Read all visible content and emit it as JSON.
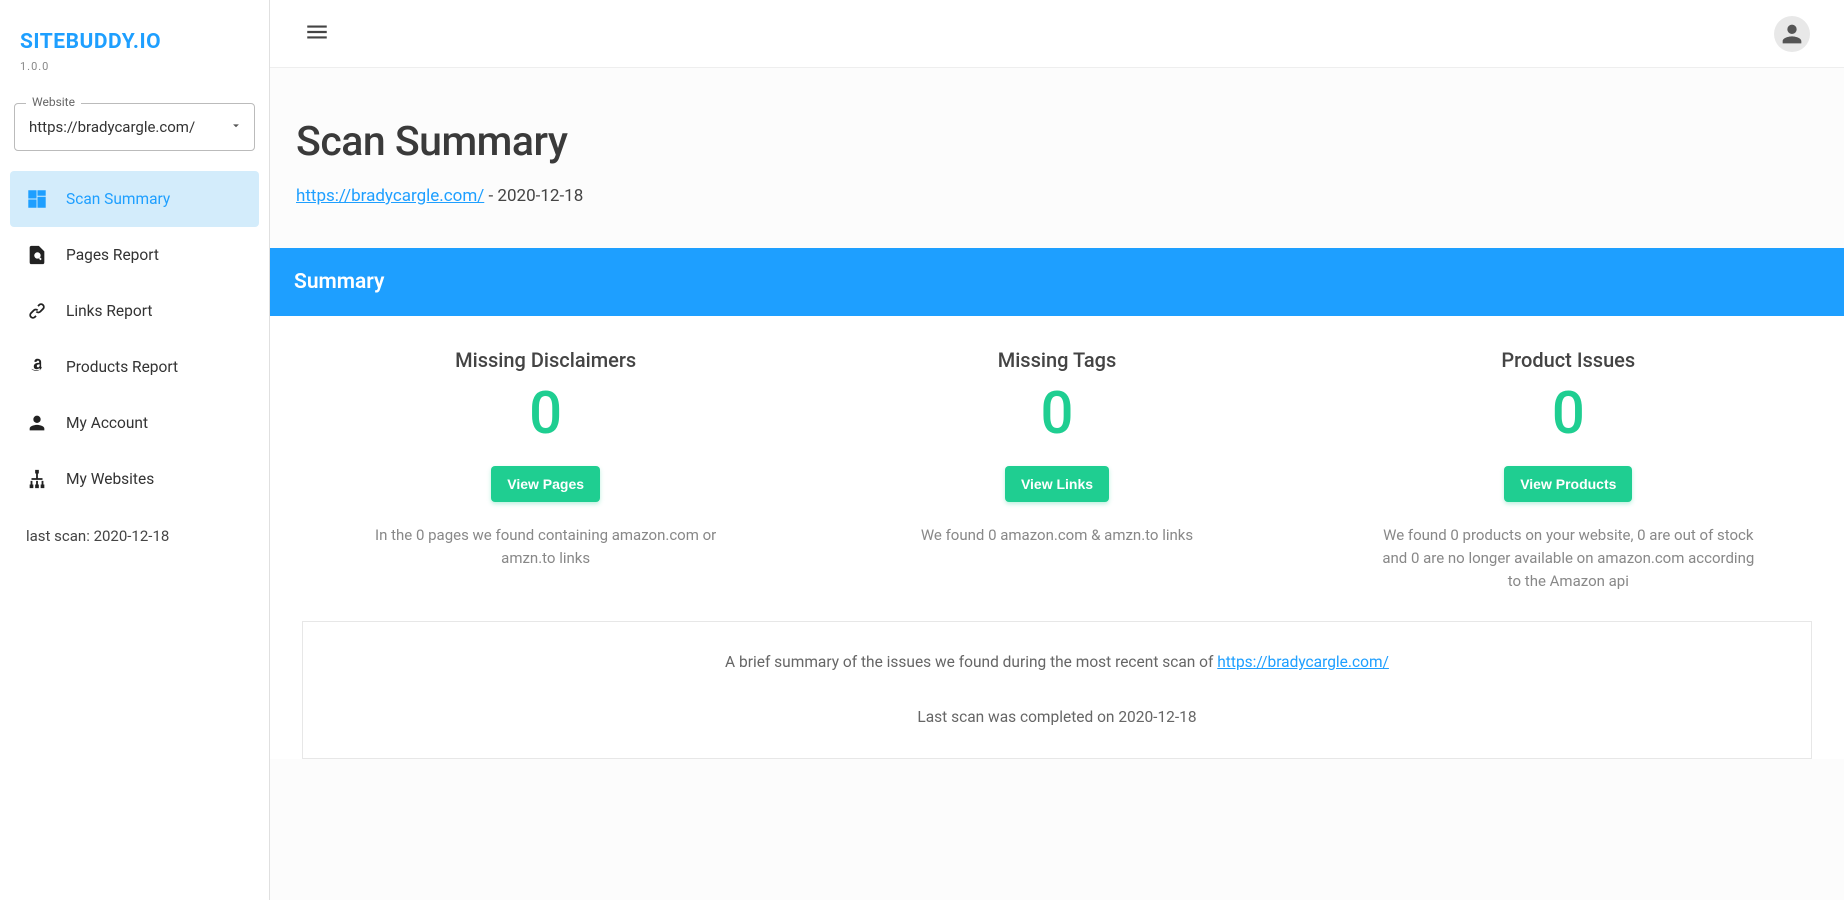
{
  "brand": {
    "name": "SITEBUDDY.IO",
    "version": "1.0.0"
  },
  "website_select": {
    "label": "Website",
    "value": "https://bradycargle.com/"
  },
  "nav": [
    {
      "label": "Scan Summary"
    },
    {
      "label": "Pages Report"
    },
    {
      "label": "Links Report"
    },
    {
      "label": "Products Report"
    },
    {
      "label": "My Account"
    },
    {
      "label": "My Websites"
    }
  ],
  "last_scan_label": "last scan: 2020-12-18",
  "page": {
    "title": "Scan Summary",
    "site_url": "https://bradycargle.com/",
    "date_sep": " - ",
    "date": "2020-12-18"
  },
  "panel": {
    "header": "Summary"
  },
  "cards": [
    {
      "title": "Missing Disclaimers",
      "count": "0",
      "button": "View Pages",
      "desc": "In the 0 pages we found containing amazon.com or amzn.to links"
    },
    {
      "title": "Missing Tags",
      "count": "0",
      "button": "View Links",
      "desc": "We found 0 amazon.com & amzn.to links"
    },
    {
      "title": "Product Issues",
      "count": "0",
      "button": "View Products",
      "desc": "We found 0 products on your website, 0 are out of stock and 0 are no longer available on amazon.com according to the Amazon api"
    }
  ],
  "footer": {
    "line1_pre": "A brief summary of the issues we found during the most recent scan of ",
    "line1_url": "https://bradycargle.com/",
    "line2": "Last scan was completed on 2020-12-18"
  }
}
